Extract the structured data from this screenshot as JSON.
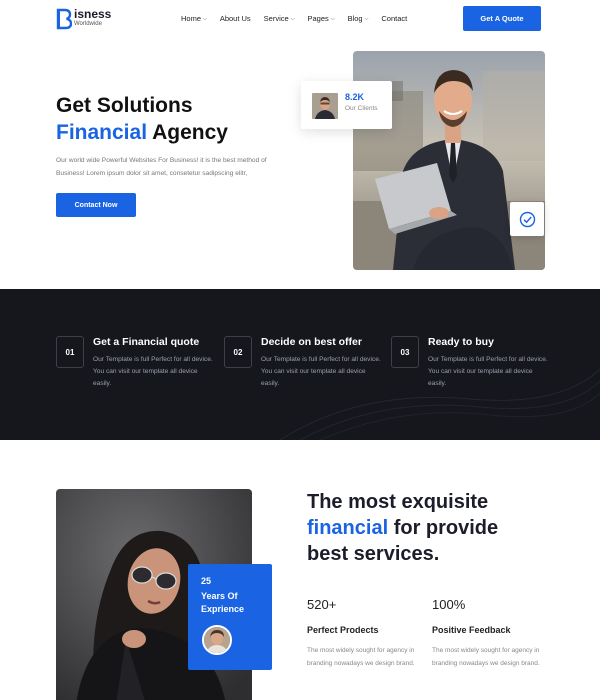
{
  "brand": {
    "letter": "B",
    "name": "isness",
    "subtitle": "Worldwide",
    "accent_color": "#1a63e3"
  },
  "nav": {
    "items": [
      {
        "label": "Home",
        "has_dropdown": true
      },
      {
        "label": "About Us",
        "has_dropdown": false
      },
      {
        "label": "Service",
        "has_dropdown": true
      },
      {
        "label": "Pages",
        "has_dropdown": true
      },
      {
        "label": "Blog",
        "has_dropdown": true
      },
      {
        "label": "Contact",
        "has_dropdown": false
      }
    ],
    "quote_button": "Get A Quote"
  },
  "hero": {
    "title_line1": "Get Solutions",
    "title_accent": "Financial",
    "title_rest": " Agency",
    "description": "Our world wide Powerful Websites For Business! it is the best method of Business! Lorem ipsum dolor sit amet, consetetur sadipscing elitr,",
    "cta": "Contact Now",
    "clients_value": "8.2K",
    "clients_label": "Our Clients",
    "check_icon": "check-circle-icon"
  },
  "steps": [
    {
      "number": "01",
      "title": "Get a Financial quote",
      "description": "Our Template is full Perfect for all device. You can visit our template all device easily."
    },
    {
      "number": "02",
      "title": "Decide on best offer",
      "description": "Our Template is full Perfect for all device. You can visit our template all device easily."
    },
    {
      "number": "03",
      "title": "Ready to buy",
      "description": "Our Template is full Perfect for all device. You can visit our template all device easily."
    }
  ],
  "about": {
    "title_line1": "The most exquisite",
    "title_accent": "financial",
    "title_rest": " for provide",
    "title_line3": "best services.",
    "years_number": "25",
    "years_text": "Years Of Exprience",
    "stats": [
      {
        "value": "520+",
        "title": "Perfect Prodects",
        "description": "The most widely sought for agency in branding nowadays we design brand."
      },
      {
        "value": "100%",
        "title": "Positive Feedback",
        "description": "The most widely sought for agency in branding nowadays we design brand."
      }
    ]
  }
}
